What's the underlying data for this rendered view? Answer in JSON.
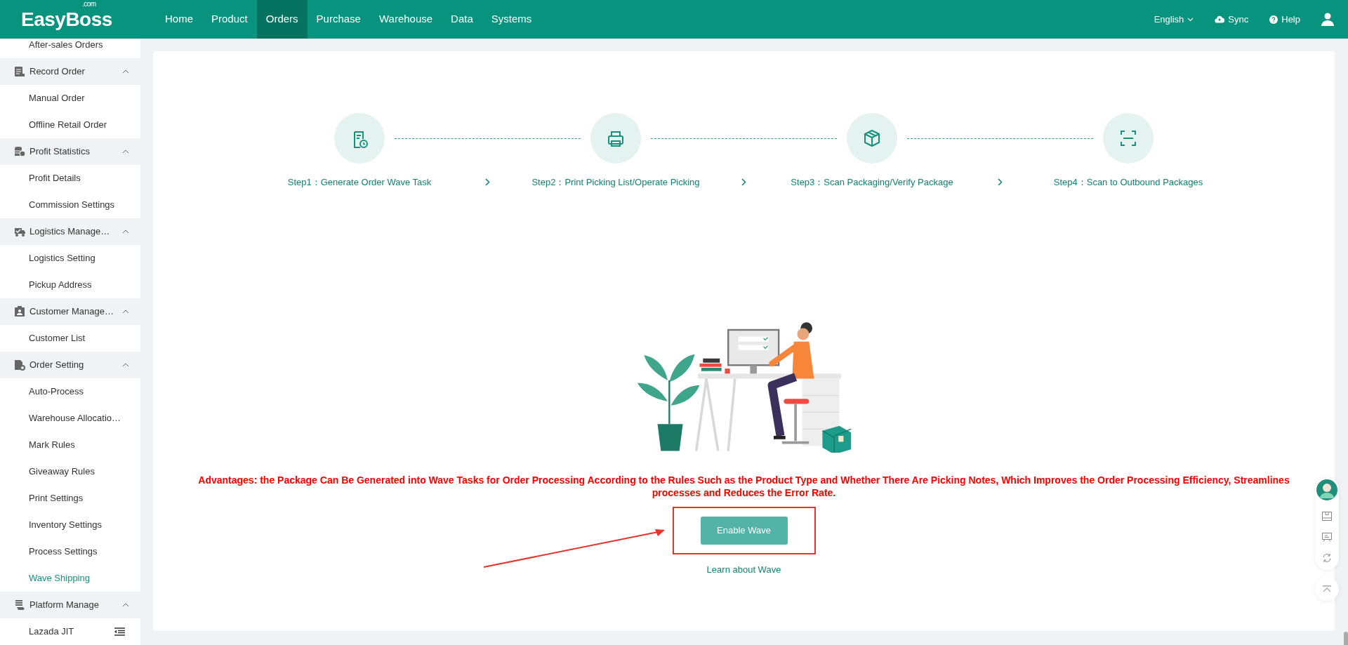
{
  "brand": {
    "name": "EasyBoss",
    "suffix": ".com"
  },
  "nav": [
    {
      "label": "Home",
      "selected": false
    },
    {
      "label": "Product",
      "selected": false
    },
    {
      "label": "Orders",
      "selected": true
    },
    {
      "label": "Purchase",
      "selected": false
    },
    {
      "label": "Warehouse",
      "selected": false
    },
    {
      "label": "Data",
      "selected": false
    },
    {
      "label": "Systems",
      "selected": false
    }
  ],
  "toolbar": {
    "language": "English",
    "sync": "Sync",
    "help": "Help"
  },
  "sidebar": {
    "items": [
      {
        "kind": "link",
        "label": "After-sales Orders",
        "selected": false
      },
      {
        "kind": "group",
        "label": "Record Order",
        "expanded": true,
        "children": [
          {
            "label": "Manual Order",
            "selected": false
          },
          {
            "label": "Offline Retail Order",
            "selected": false
          }
        ]
      },
      {
        "kind": "group",
        "label": "Profit Statistics",
        "expanded": true,
        "children": [
          {
            "label": "Profit Details",
            "selected": false
          },
          {
            "label": "Commission Settings",
            "selected": false
          }
        ]
      },
      {
        "kind": "group",
        "label": "Logistics Manage…",
        "expanded": true,
        "children": [
          {
            "label": "Logistics Setting",
            "selected": false
          },
          {
            "label": "Pickup Address",
            "selected": false
          }
        ]
      },
      {
        "kind": "group",
        "label": "Customer Manage…",
        "expanded": true,
        "children": [
          {
            "label": "Customer List",
            "selected": false
          }
        ]
      },
      {
        "kind": "group",
        "label": "Order Setting",
        "expanded": true,
        "children": [
          {
            "label": "Auto-Process",
            "selected": false
          },
          {
            "label": "Warehouse Allocatio…",
            "selected": false
          },
          {
            "label": "Mark Rules",
            "selected": false
          },
          {
            "label": "Giveaway Rules",
            "selected": false
          },
          {
            "label": "Print Settings",
            "selected": false
          },
          {
            "label": "Inventory Settings",
            "selected": false
          },
          {
            "label": "Process Settings",
            "selected": false
          },
          {
            "label": "Wave Shipping",
            "selected": true
          }
        ]
      },
      {
        "kind": "group",
        "label": "Platform Manage",
        "expanded": true,
        "children": [
          {
            "label": "Lazada JIT",
            "selected": false
          }
        ]
      }
    ]
  },
  "steps": [
    {
      "label": "Step1：Generate Order Wave Task"
    },
    {
      "label": "Step2：Print Picking List/Operate Picking"
    },
    {
      "label": "Step3：Scan Packaging/Verify Package"
    },
    {
      "label": "Step4：Scan to Outbound Packages"
    }
  ],
  "intro": {
    "advantages": "Advantages: the Package Can Be Generated into Wave Tasks for Order Processing According to the Rules Such as the Product Type and Whether There Are Picking Notes, Which Improves the Order Processing Efficiency, Streamlines processes and Reduces the Error Rate.",
    "button": "Enable Wave",
    "link": "Learn about Wave"
  }
}
